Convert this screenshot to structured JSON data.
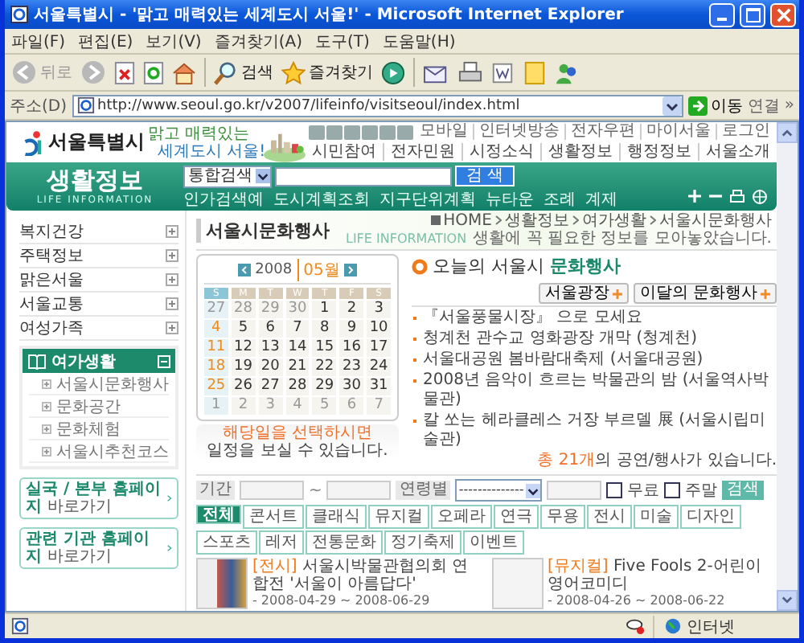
{
  "window": {
    "title": "서울특별시 - '맑고 매력있는 세계도시 서울!' - Microsoft Internet Explorer"
  },
  "menu": [
    "파일(F)",
    "편집(E)",
    "보기(V)",
    "즐겨찾기(A)",
    "도구(T)",
    "도움말(H)"
  ],
  "toolbar": {
    "back": "뒤로",
    "search": "검색",
    "favorites": "즐겨찾기"
  },
  "address": {
    "label": "주소(D)",
    "url": "http://www.seoul.go.kr/v2007/lifeinfo/visitseoul/index.html",
    "go": "이동",
    "links": "연결",
    "more": "»"
  },
  "site": {
    "logo": "서울특별시",
    "slogan_1": "맑고 매력있는",
    "slogan_2": "세계도시 서울!",
    "top_links": [
      "모바일",
      "인터넷방송",
      "전자우편",
      "마이서울",
      "로그인"
    ],
    "nav": [
      "시민참여",
      "전자민원",
      "시정소식",
      "생활정보",
      "행정정보",
      "서울소개"
    ]
  },
  "section": {
    "title": "생활정보",
    "subtitle": "LIFE INFORMATION",
    "search_scope": "통합검색",
    "search_button": "검 색",
    "quick_links": [
      "인가검색예",
      "도시계획조회",
      "지구단위계획",
      "뉴타운",
      "조례",
      "계제"
    ]
  },
  "banner": {
    "page_title": "서울시문화행사",
    "label": "LIFE INFORMATION",
    "breadcrumb": [
      "HOME",
      "생활정보",
      "여가생활",
      "서울시문화행사"
    ],
    "description": "생활에 꼭 필요한 정보를 모아놓았습니다."
  },
  "sidebar": {
    "items": [
      {
        "label": "복지건강",
        "expanded": false
      },
      {
        "label": "주택정보",
        "expanded": false
      },
      {
        "label": "맑은서울",
        "expanded": false
      },
      {
        "label": "서울교통",
        "expanded": false
      },
      {
        "label": "여성가족",
        "expanded": false
      },
      {
        "label": "여가생활",
        "expanded": true,
        "children": [
          {
            "label": "서울시문화행사"
          },
          {
            "label": "문화공간"
          },
          {
            "label": "문화체험"
          },
          {
            "label": "서울시추천코스"
          }
        ]
      }
    ],
    "links": [
      {
        "label": "실국 / 본부 홈페이지",
        "suffix": "바로가기"
      },
      {
        "label": "관련 기관 홈페이지",
        "suffix": "바로가기"
      }
    ]
  },
  "calendar": {
    "year": "2008",
    "month": "05월",
    "weekdays": [
      "S",
      "M",
      "T",
      "W",
      "T",
      "F",
      "S"
    ],
    "weeks": [
      [
        {
          "text": "27",
          "muted": true
        },
        {
          "text": "28",
          "muted": true
        },
        {
          "text": "29",
          "muted": true
        },
        {
          "text": "30",
          "muted": true
        },
        {
          "text": "1",
          "muted": false
        },
        {
          "text": "2",
          "muted": false
        },
        {
          "text": "3",
          "muted": false
        }
      ],
      [
        {
          "text": "4",
          "muted": false
        },
        {
          "text": "5",
          "muted": false
        },
        {
          "text": "6",
          "muted": false
        },
        {
          "text": "7",
          "muted": false
        },
        {
          "text": "8",
          "muted": false
        },
        {
          "text": "9",
          "muted": false
        },
        {
          "text": "10",
          "muted": false
        }
      ],
      [
        {
          "text": "11",
          "muted": false
        },
        {
          "text": "12",
          "muted": false
        },
        {
          "text": "13",
          "muted": false
        },
        {
          "text": "14",
          "muted": false
        },
        {
          "text": "15",
          "muted": false
        },
        {
          "text": "16",
          "muted": false
        },
        {
          "text": "17",
          "muted": false
        }
      ],
      [
        {
          "text": "18",
          "muted": false
        },
        {
          "text": "19",
          "muted": false
        },
        {
          "text": "20",
          "muted": false
        },
        {
          "text": "21",
          "muted": false
        },
        {
          "text": "22",
          "muted": false
        },
        {
          "text": "23",
          "muted": false
        },
        {
          "text": "24",
          "muted": false
        }
      ],
      [
        {
          "text": "25",
          "muted": false
        },
        {
          "text": "26",
          "muted": false
        },
        {
          "text": "27",
          "muted": false
        },
        {
          "text": "28",
          "muted": false
        },
        {
          "text": "29",
          "muted": false
        },
        {
          "text": "30",
          "muted": false
        },
        {
          "text": "31",
          "muted": false
        }
      ],
      [
        {
          "text": "1",
          "muted": true
        },
        {
          "text": "2",
          "muted": true
        },
        {
          "text": "3",
          "muted": true
        },
        {
          "text": "4",
          "muted": true
        },
        {
          "text": "5",
          "muted": true
        },
        {
          "text": "6",
          "muted": true
        },
        {
          "text": "7",
          "muted": true
        }
      ]
    ],
    "hint_1": "해당일을 선택하시면",
    "hint_2": "일정을 보실 수 있습니다."
  },
  "events": {
    "title": "오늘의 서울시",
    "title_highlight": "문화행사",
    "buttons": [
      "서울광장",
      "이달의 문화행사"
    ],
    "items": [
      "『서울풍물시장』 으로 모세요",
      "청계천 관수교 영화광장 개막 (청계천)",
      "서울대공원 봄바람대축제 (서울대공원)",
      "2008년 음악이 흐르는 박물관의 밤 (서울역사박물관)",
      "칼 쏘는 헤라클레스 거장 부르델 展 (서울시립미술관)"
    ],
    "count_highlight": "총 21개",
    "count_rest": "의 공연/행사가 있습니다."
  },
  "search": {
    "period_label": "기간",
    "tilde": "~",
    "age_label": "연령별",
    "age_value": "--------------",
    "options": [
      {
        "label": "무료",
        "checked": false
      },
      {
        "label": "주말",
        "checked": false
      }
    ],
    "button": "검색"
  },
  "tabs": [
    {
      "label": "전체",
      "selected": true
    },
    {
      "label": "콘서트",
      "selected": false
    },
    {
      "label": "클래식",
      "selected": false
    },
    {
      "label": "뮤지컬",
      "selected": false
    },
    {
      "label": "오페라",
      "selected": false
    },
    {
      "label": "연극",
      "selected": false
    },
    {
      "label": "무용",
      "selected": false
    },
    {
      "label": "전시",
      "selected": false
    },
    {
      "label": "미술",
      "selected": false
    },
    {
      "label": "디자인",
      "selected": false
    },
    {
      "label": "스포츠",
      "selected": false
    },
    {
      "label": "레저",
      "selected": false
    },
    {
      "label": "전통문화",
      "selected": false
    },
    {
      "label": "정기축제",
      "selected": false
    },
    {
      "label": "이벤트",
      "selected": false
    }
  ],
  "cards": [
    {
      "category": "[전시]",
      "title": "서울시박물관협의회 연합전 '서울이 아름답다'",
      "dates": "- 2008-04-29 ~ 2008-06-29"
    },
    {
      "category": "[뮤지컬]",
      "title": "Five Fools 2-어린이영어코미디",
      "dates": "- 2008-04-26 ~ 2008-06-22"
    }
  ],
  "status": {
    "zone": "인터넷"
  }
}
